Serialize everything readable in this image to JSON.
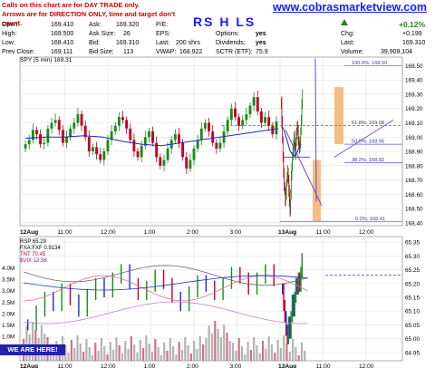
{
  "notice": {
    "line1": "Calls on this chart are for DAY TRADE only.",
    "line2": "Arrows are for DIRECTION ONLY, time and target don't count."
  },
  "website": "www.cobrasmarketview.com",
  "annotation": "RS H LS",
  "stats": {
    "open_label": "Open:",
    "open": "169.410",
    "high_label": "High:",
    "high": "169.500",
    "low_label": "Low:",
    "low": "168.410",
    "prev_close_label": "Prev Close:",
    "prev_close": "169.111",
    "ask_label": "Ask:",
    "ask": "169.320",
    "ask_size_label": "Ask Size:",
    "ask_size": "26",
    "bid_label": "Bid:",
    "bid": "169.310",
    "bid_size_label": "Bid Size:",
    "bid_size": "113",
    "pe_label": "P/E:",
    "pe": "",
    "eps_label": "EPS:",
    "eps": "",
    "last_size_label": "Last:",
    "last_size": "200 shrs",
    "vwap_label": "VWAP:",
    "vwap": "168.922",
    "options_label": "Options:",
    "options": "yes",
    "dividends_label": "Dividends:",
    "dividends": "yes",
    "last_label": "Last:",
    "last": "",
    "sctr_label": "SCTR (ETF):",
    "sctr": "75.9",
    "chg_pct": "+0.12%",
    "chg_label": "Chg:",
    "chg": "+0.199",
    "last_price_label": "Last:",
    "last_price": "169.310",
    "volume_label": "Volume:",
    "volume": "39,909,104"
  },
  "main_legend": "SPY (5 min) 169.31",
  "rsi_legend": {
    "rsp": "RSP  65.29",
    "fxa": "FXA:FXF  0.9134",
    "tnt": "TNT  70.45",
    "vix": "$VIX  12.56"
  },
  "we_are_here": "WE ARE HERE!",
  "colors": {
    "up": "#1a8a1a",
    "down": "#c00020",
    "blue_bars": "#1a2bd0",
    "ma": "#1a2bd0",
    "trend": "#6b48d8",
    "rect": "#f5b26c",
    "notice": "#d40000",
    "link": "#1a1aff"
  },
  "chart_data": [
    {
      "type": "candlestick",
      "title": "SPY (5 min) 169.31",
      "ylim": [
        168.38,
        169.56
      ],
      "y_ticks": [
        169.5,
        169.4,
        169.3,
        169.2,
        169.1,
        169.0,
        168.9,
        168.8,
        168.7,
        168.6,
        168.5,
        168.4
      ],
      "x_ticks": [
        "12Aug",
        "11:00",
        "12:00",
        "1:00",
        "2:00",
        "3:00",
        "13Aug",
        "11:00",
        "12:00",
        "1:00",
        "2:00",
        "3:00"
      ],
      "fibonacci": [
        {
          "label": "100.0%: 169.50",
          "price": 169.5
        },
        {
          "label": "61.8%: 169.08",
          "price": 169.08
        },
        {
          "label": "50.0%: 168.95",
          "price": 168.95
        },
        {
          "label": "38.2%: 168.82",
          "price": 168.82
        },
        {
          "label": "0.0%: 168.41",
          "price": 168.41
        }
      ],
      "close_series": {
        "12Aug": [
          168.95,
          168.98,
          169.05,
          169.02,
          168.95,
          168.96,
          169.06,
          169.1,
          169.12,
          169.05,
          168.96,
          169.0,
          169.06,
          169.1,
          169.16,
          169.08,
          169.0,
          168.9,
          168.93,
          168.88,
          168.84,
          168.9,
          168.98,
          169.04,
          169.08,
          169.14,
          169.12,
          169.06,
          168.98,
          168.9,
          168.86,
          168.94,
          169.0,
          169.04,
          168.96,
          168.86,
          168.8,
          168.84,
          168.92,
          168.98,
          169.02,
          168.96,
          168.86,
          168.78,
          168.84,
          168.92,
          168.98,
          169.06,
          169.1,
          169.04,
          168.96,
          168.92,
          168.96,
          169.04,
          169.12,
          169.2,
          169.14,
          169.08,
          169.12,
          169.16,
          169.22,
          169.28,
          169.18,
          169.1,
          169.14,
          169.08,
          169.02,
          169.11
        ],
        "13Aug": [
          169.25,
          169.1,
          168.98,
          168.86,
          168.74,
          168.66,
          168.62,
          168.55,
          168.6,
          168.68,
          168.72,
          168.76,
          168.7,
          168.62,
          168.54,
          168.48,
          168.6,
          168.72,
          168.8,
          168.86,
          168.9,
          168.96,
          169.0,
          168.94,
          168.88,
          168.96,
          169.02,
          169.08,
          169.04,
          168.98,
          168.94,
          168.92,
          168.96,
          169.04,
          169.12,
          169.22,
          169.31
        ]
      },
      "moving_average": {
        "12Aug": [
          168.99,
          169.0,
          169.0,
          169.01,
          169.0,
          168.97,
          168.95,
          168.94,
          168.96,
          168.98,
          169.0,
          169.02,
          169.04,
          169.06
        ],
        "13Aug": [
          169.08,
          169.05,
          169.0,
          168.95,
          168.9,
          168.88,
          168.87,
          168.89,
          168.92,
          168.95
        ]
      }
    },
    {
      "type": "line",
      "title": "RSP / FXA:FXF / TNT / $VIX ratio panel",
      "ylim": [
        64.92,
        65.37
      ],
      "y_ticks": [
        65.35,
        65.3,
        65.25,
        65.2,
        65.15,
        65.1,
        65.05,
        65.0,
        64.95
      ],
      "volume_ticks": [
        "4.0M",
        "3.5M",
        "3.0M",
        "2.5M",
        "2.0M",
        "1.5M",
        "1.0M",
        "500K"
      ],
      "rsp_close": {
        "12Aug": [
          65.05,
          65.1,
          65.15,
          65.12,
          65.18,
          65.14,
          65.1,
          65.16,
          65.2,
          65.17,
          65.22,
          65.25,
          65.2,
          65.16,
          65.19,
          65.23,
          65.2,
          65.15,
          65.12,
          65.17,
          65.21,
          65.19,
          65.16,
          65.2,
          65.24,
          65.22,
          65.18,
          65.22,
          65.25,
          65.21
        ],
        "13Aug": [
          65.18,
          65.12,
          65.08,
          65.03,
          65.0,
          65.06,
          65.02,
          65.08,
          65.14,
          65.1,
          65.15,
          65.2,
          65.18,
          65.22,
          65.19,
          65.24,
          65.29
        ]
      },
      "reference_level": 65.23
    }
  ]
}
